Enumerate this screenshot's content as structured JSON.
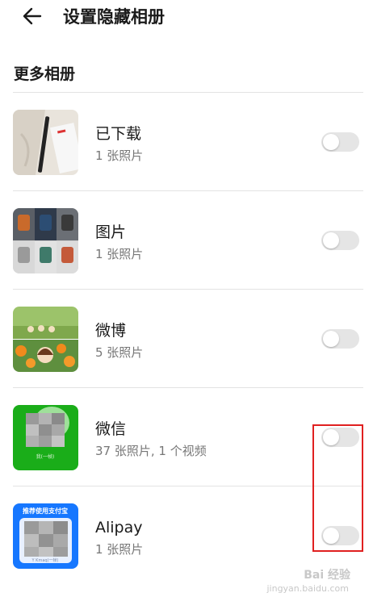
{
  "header": {
    "title": "设置隐藏相册",
    "back_icon": "arrow-left-icon"
  },
  "section_title": "更多相册",
  "albums": [
    {
      "name": "已下载",
      "count": "1 张照片",
      "enabled": false
    },
    {
      "name": "图片",
      "count": "1 张照片",
      "enabled": false
    },
    {
      "name": "微博",
      "count": "5 张照片",
      "enabled": false
    },
    {
      "name": "微信",
      "count": "37 张照片, 1 个视频",
      "enabled": false
    },
    {
      "name": "Alipay",
      "count": "1 张照片",
      "enabled": false
    }
  ],
  "thumb_texts": {
    "wechat": "我(一帧)",
    "alipay_banner": "推荐使用支付宝",
    "alipay_footer": "Y Kmaq(一帧)"
  },
  "watermark": {
    "brand": "Bai 经验",
    "site": "jingyan.baidu.com"
  },
  "colors": {
    "toggle_off": "#e5e5e5",
    "highlight": "#e02020",
    "wechat_green": "#1aad19",
    "alipay_blue": "#1677ff"
  }
}
